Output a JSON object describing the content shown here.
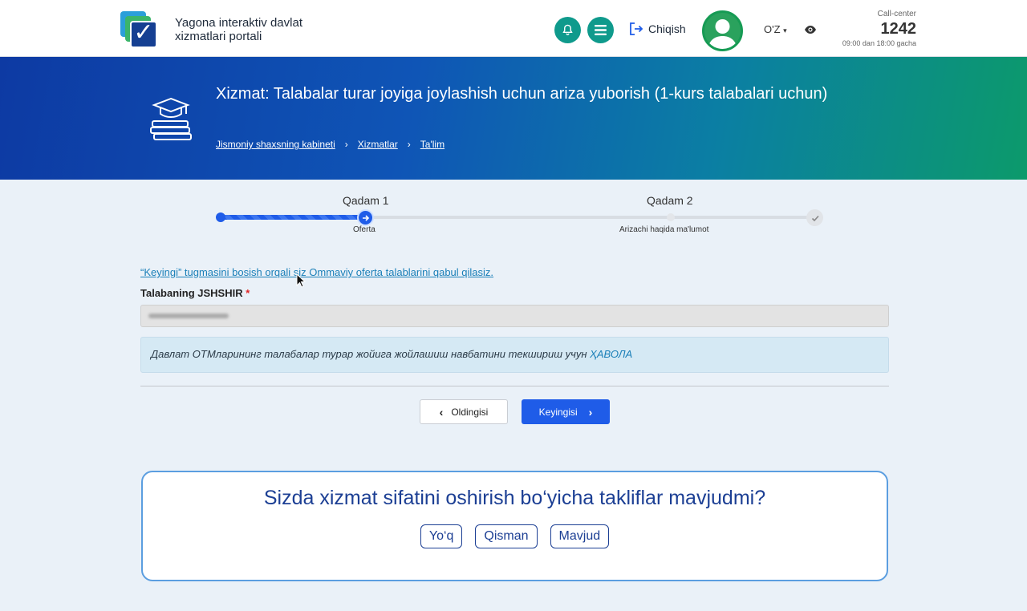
{
  "header": {
    "portal_name": "Yagona interaktiv davlat xizmatlari portali",
    "logout_label": "Chiqish",
    "language": "O'Z",
    "call_center_label": "Call-center",
    "call_center_number": "1242",
    "call_center_hours": "09:00 dan 18:00 gacha"
  },
  "banner": {
    "title": "Xizmat: Talabalar turar joyiga joylashish uchun ariza yuborish (1-kurs talabalari uchun)",
    "breadcrumb": [
      "Jismoniy shaxsning kabineti",
      "Xizmatlar",
      "Ta'lim"
    ]
  },
  "stepper": {
    "steps": [
      {
        "label": "Qadam 1",
        "sublabel": "Oferta"
      },
      {
        "label": "Qadam 2",
        "sublabel": "Arizachi haqida ma'lumot"
      }
    ]
  },
  "form": {
    "offer_text": "“Keyingi” tugmasini bosish orqali siz Ommaviy oferta talablarini qabul qilasiz.",
    "field_label": "Talabaning JSHSHIR",
    "required_mark": "*",
    "info_text": "Давлат ОТМларининг талабалар турар жойига жойлашиш навбатини текшириш учун",
    "info_link": "ҲАВОЛА",
    "prev_label": "Oldingisi",
    "next_label": "Keyingisi"
  },
  "feedback": {
    "question": "Sizda xizmat sifatini oshirish bo‘yicha takliflar mavjudmi?",
    "options": [
      "Yo‘q",
      "Qisman",
      "Mavjud"
    ]
  },
  "colors": {
    "accent": "#1f5ce8",
    "teal": "#0f9a8c",
    "dark_blue": "#1c3f94"
  }
}
